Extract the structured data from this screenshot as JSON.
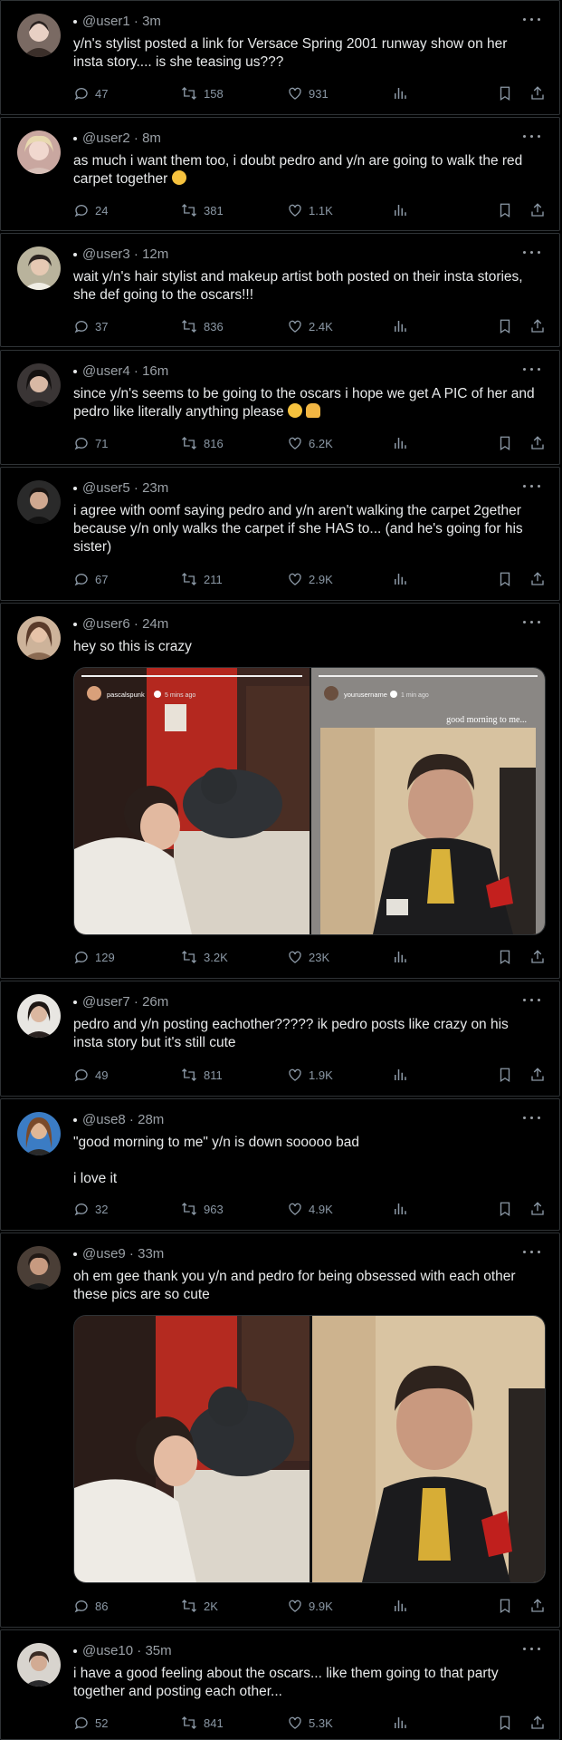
{
  "colors": {
    "background": "#000000",
    "text": "#e7e9ea",
    "muted": "#8b98a5",
    "border": "#2f3336"
  },
  "posts": [
    {
      "handle": "@user1",
      "time": "3m",
      "text": "y/n's stylist posted a link for Versace Spring 2001 runway show on her insta story.... is she teasing us???",
      "replies": "47",
      "reposts": "158",
      "likes": "931"
    },
    {
      "handle": "@user2",
      "time": "8m",
      "text": "as much i want them too, i doubt pedro and y/n are going to walk the red carpet together",
      "emoji": "confused-face",
      "replies": "24",
      "reposts": "381",
      "likes": "1.1K"
    },
    {
      "handle": "@user3",
      "time": "12m",
      "text": "wait y/n's hair stylist and makeup artist both posted on their insta stories, she def going to the oscars!!!",
      "replies": "37",
      "reposts": "836",
      "likes": "2.4K"
    },
    {
      "handle": "@user4",
      "time": "16m",
      "text": "since y/n's seems to be going to the oscars i hope we get A PIC of her and pedro like literally anything please",
      "emoji": "crying-and-pray",
      "replies": "71",
      "reposts": "816",
      "likes": "6.2K"
    },
    {
      "handle": "@user5",
      "time": "23m",
      "text": "i agree with oomf saying pedro and y/n aren't walking the carpet 2gether because y/n only walks the carpet if she HAS to... (and he's going for his sister)",
      "replies": "67",
      "reposts": "211",
      "likes": "2.9K"
    },
    {
      "handle": "@user6",
      "time": "24m",
      "text": "hey so this is crazy",
      "replies": "129",
      "reposts": "3.2K",
      "likes": "23K",
      "media": {
        "left_user": "pascalspunk",
        "left_time": "5 mins ago",
        "right_user": "yourusername",
        "right_time": "1 min ago",
        "right_caption": "good morning to me..."
      }
    },
    {
      "handle": "@user7",
      "time": "26m",
      "text": "pedro and y/n posting eachother????? ik pedro posts like crazy on his insta story but it's still cute",
      "replies": "49",
      "reposts": "811",
      "likes": "1.9K"
    },
    {
      "handle": "@use8",
      "time": "28m",
      "text": "\"good morning to me\" y/n is down sooooo bad\n\ni love it",
      "replies": "32",
      "reposts": "963",
      "likes": "4.9K"
    },
    {
      "handle": "@use9",
      "time": "33m",
      "text": "oh em gee thank you y/n and pedro for being obsessed with each other these pics are so cute",
      "replies": "86",
      "reposts": "2K",
      "likes": "9.9K"
    },
    {
      "handle": "@use10",
      "time": "35m",
      "text": "i have a good feeling about the oscars... like them going to that party together and posting each other...",
      "replies": "52",
      "reposts": "841",
      "likes": "5.3K"
    }
  ],
  "icons": {
    "reply": "reply-icon",
    "repost": "repost-icon",
    "like": "heart-icon",
    "views": "views-icon",
    "bookmark": "bookmark-icon",
    "share": "share-icon",
    "more": "more-icon"
  }
}
